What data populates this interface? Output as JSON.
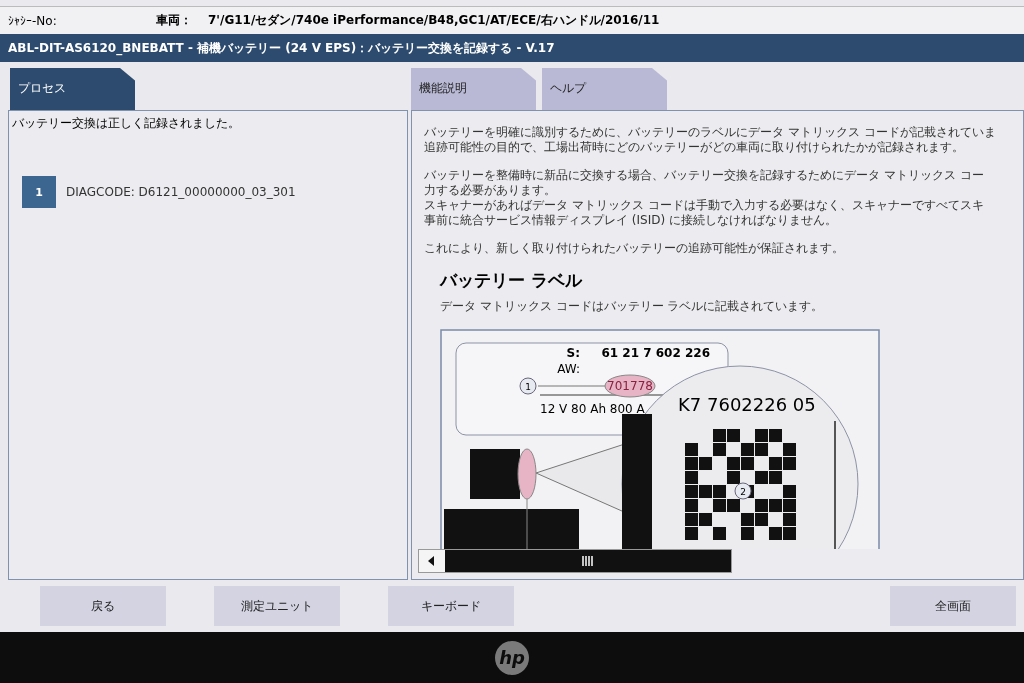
{
  "info_bar": {
    "chassis_label": "ｼｬｼｰ-No:",
    "vehicle_label": "車両：",
    "vehicle_value": "7'/G11/セダン/740e iPerformance/B48,GC1/AT/ECE/右ハンドル/2016/11"
  },
  "title_bar": {
    "title": "ABL-DIT-AS6120_BNEBATT - 補機バッテリー (24 V EPS)：バッテリー交換を記録する - V.17"
  },
  "left_tabs": [
    {
      "label": "プロセス",
      "selected": true
    }
  ],
  "right_tabs": [
    {
      "label": "機能説明",
      "selected": false
    },
    {
      "label": "ヘルプ",
      "selected": false
    }
  ],
  "process": {
    "message": "バッテリー交換は正しく記録されました。",
    "steps": [
      {
        "number": "1",
        "text": "DIAGCODE: D6121_00000000_03_301"
      }
    ]
  },
  "help": {
    "paragraphs": [
      [
        "バッテリーを明確に識別するために、バッテリーのラベルにデータ マトリックス コードが記載されていま",
        "追跡可能性の目的で、工場出荷時にどのバッテリーがどの車両に取り付けられたかが記録されます。"
      ],
      [
        "バッテリーを整備時に新品に交換する場合、バッテリー交換を記録するためにデータ マトリックス コー",
        "力する必要があります。",
        "スキャナーがあればデータ マトリックス コードは手動で入力する必要はなく、スキャナーですべてスキ",
        "事前に統合サービス情報ディスプレイ (ISID) に接続しなければなりません。"
      ],
      [
        "これにより、新しく取り付けられたバッテリーの追跡可能性が保証されます。"
      ]
    ],
    "heading": "バッテリー ラベル",
    "caption": "データ マトリックス コードはバッテリー ラベルに記載されています。",
    "label": {
      "s_key": "S:",
      "s_value": "61 21 7 602 226",
      "aw_key": "AW:",
      "highlight": "701778",
      "ratings": "12 V  80 Ah   800 A",
      "callout_1": "1",
      "zoom_code": "K7 7602226 05",
      "callout_2": "2"
    }
  },
  "buttons": [
    {
      "label": "戻る"
    },
    {
      "label": "測定ユニット"
    },
    {
      "label": "キーボード"
    },
    {
      "label": "全画面"
    }
  ],
  "bezel": {
    "logo": "hp"
  }
}
